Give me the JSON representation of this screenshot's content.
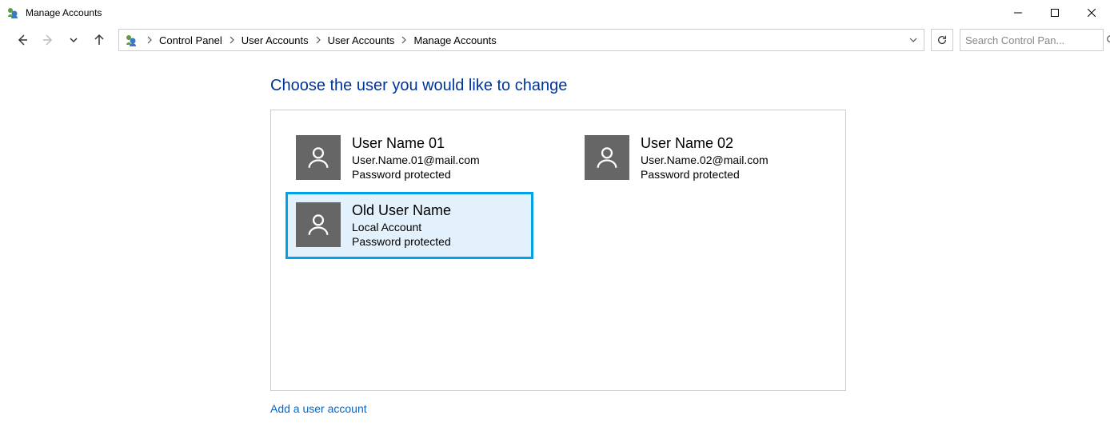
{
  "window": {
    "title": "Manage Accounts"
  },
  "breadcrumb": {
    "items": [
      "Control Panel",
      "User Accounts",
      "User Accounts",
      "Manage Accounts"
    ]
  },
  "search": {
    "placeholder": "Search Control Pan..."
  },
  "page": {
    "heading": "Choose the user you would like to change",
    "add_link": "Add a user account"
  },
  "accounts": [
    {
      "name": "User Name 01",
      "line2": "User.Name.01@mail.com",
      "line3": "Password protected",
      "selected": false
    },
    {
      "name": "User Name 02",
      "line2": "User.Name.02@mail.com",
      "line3": "Password protected",
      "selected": false
    },
    {
      "name": "Old User Name",
      "line2": "Local Account",
      "line3": "Password protected",
      "selected": true
    }
  ]
}
